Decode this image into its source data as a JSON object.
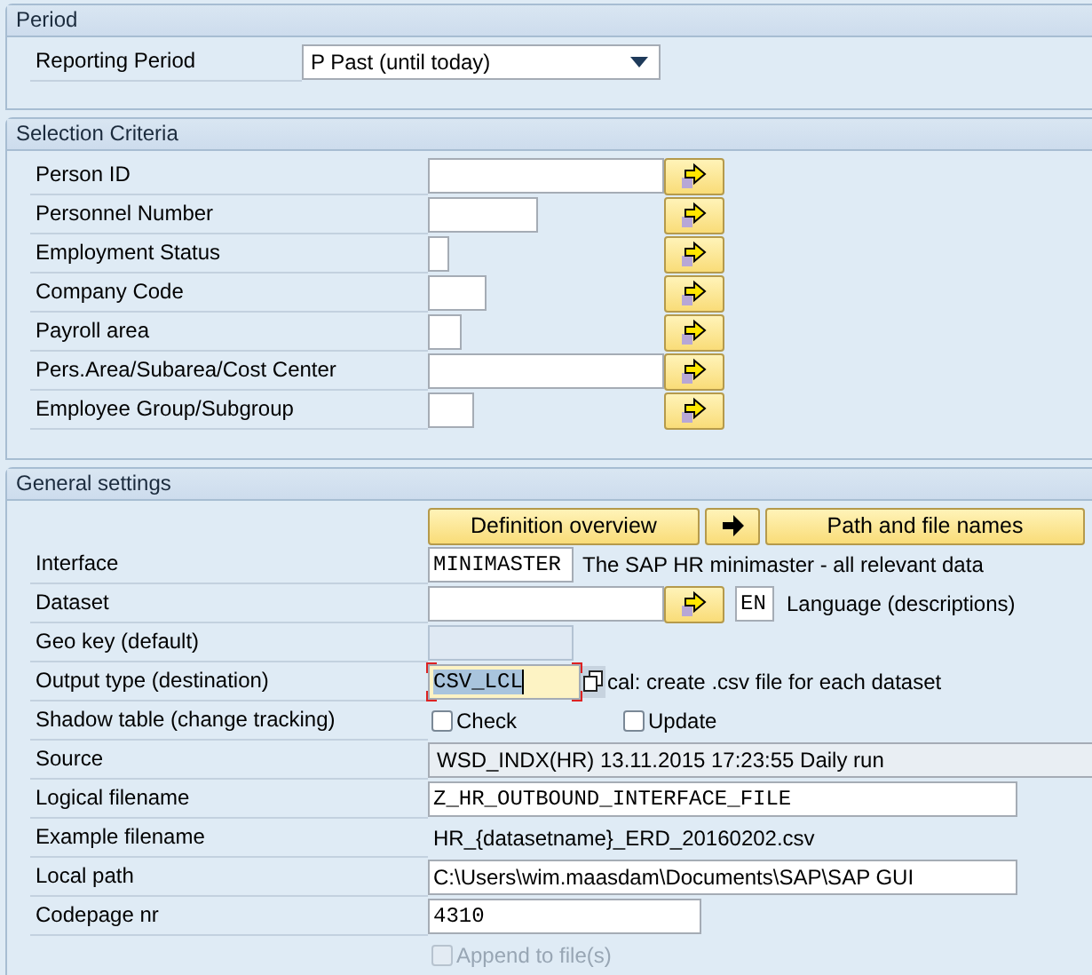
{
  "period": {
    "title": "Period",
    "reporting_period": {
      "label": "Reporting Period",
      "value": "P Past (until today)"
    }
  },
  "selection": {
    "title": "Selection Criteria",
    "rows": [
      {
        "label": "Person ID",
        "value": ""
      },
      {
        "label": "Personnel Number",
        "value": ""
      },
      {
        "label": "Employment Status",
        "value": ""
      },
      {
        "label": "Company Code",
        "value": ""
      },
      {
        "label": "Payroll area",
        "value": ""
      },
      {
        "label": "Pers.Area/Subarea/Cost Center",
        "value": ""
      },
      {
        "label": "Employee Group/Subgroup",
        "value": ""
      }
    ]
  },
  "general": {
    "title": "General settings",
    "buttons": [
      {
        "kind": "text",
        "label": "Definition overview"
      },
      {
        "kind": "arrow"
      },
      {
        "kind": "text",
        "label": "Path and file names"
      }
    ],
    "rows": [
      {
        "kind": "input",
        "label": "Interface",
        "value": "MINIMASTER",
        "description": "The SAP HR minimaster - all relevant data"
      },
      {
        "kind": "dataset",
        "label": "Dataset",
        "value": "",
        "language": "EN",
        "description": "Language (descriptions)"
      },
      {
        "kind": "input",
        "label": "Geo key (default)",
        "value": "",
        "disabled": true
      },
      {
        "kind": "output",
        "label": "Output type (destination)",
        "value": "CSV_LCL",
        "focused": true,
        "description": "cal: create .csv file for each dataset"
      },
      {
        "kind": "checks",
        "label": "Shadow table (change tracking)",
        "checks": [
          {
            "label": "Check",
            "checked": false
          },
          {
            "label": "Update",
            "checked": false
          }
        ]
      },
      {
        "kind": "display",
        "label": "Source",
        "value": "WSD_INDX(HR) 13.11.2015 17:23:55 Daily run"
      },
      {
        "kind": "input",
        "label": "Logical filename",
        "value": "Z_HR_OUTBOUND_INTERFACE_FILE"
      },
      {
        "kind": "text",
        "label": "Example filename",
        "value": "HR_{datasetname}_ERD_20160202.csv"
      },
      {
        "kind": "input",
        "label": "Local path",
        "value": "C:\\Users\\wim.maasdam\\Documents\\SAP\\SAP GUI"
      },
      {
        "kind": "input",
        "label": "Codepage nr",
        "value": "4310"
      },
      {
        "kind": "checkbox",
        "checkbox": {
          "label": "Append to file(s)",
          "checked": false,
          "disabled": true
        }
      }
    ]
  }
}
